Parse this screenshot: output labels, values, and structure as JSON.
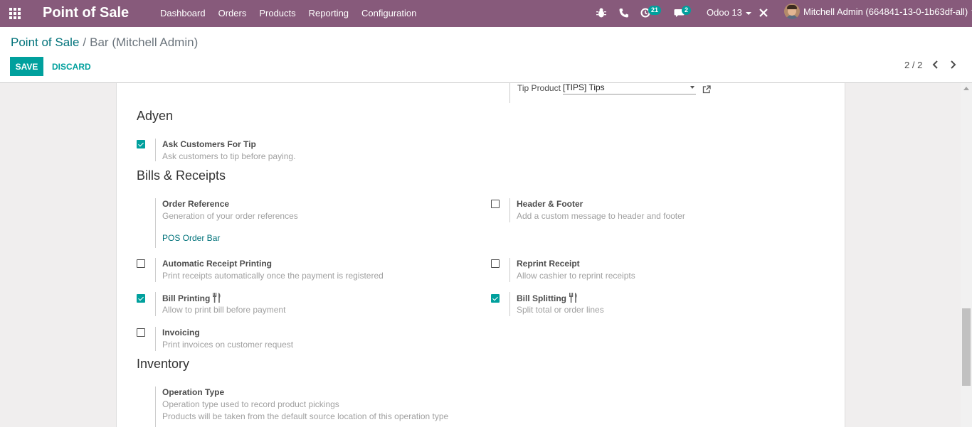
{
  "navbar": {
    "brand": "Point of Sale",
    "menu": [
      "Dashboard",
      "Orders",
      "Products",
      "Reporting",
      "Configuration"
    ],
    "activity_count": "21",
    "message_count": "2",
    "db_switcher": "Odoo 13",
    "user_name": "Mitchell Admin (664841-13-0-1b63df-all)"
  },
  "breadcrumb": {
    "parent": "Point of Sale",
    "separator": "/",
    "current": "Bar (Mitchell Admin)"
  },
  "buttons": {
    "save": "SAVE",
    "discard": "DISCARD"
  },
  "pager": {
    "value": "2 / 2"
  },
  "tip": {
    "label": "Tip Product",
    "value": "[TIPS] Tips"
  },
  "sections": {
    "adyen": "Adyen",
    "bills": "Bills & Receipts",
    "inventory": "Inventory"
  },
  "settings": {
    "ask_tip": {
      "label": "Ask Customers For Tip",
      "help": "Ask customers to tip before paying.",
      "checked": true
    },
    "order_ref": {
      "label": "Order Reference",
      "help": "Generation of your order references",
      "link": "POS Order Bar"
    },
    "header_footer": {
      "label": "Header & Footer",
      "help": "Add a custom message to header and footer",
      "checked": false
    },
    "auto_print": {
      "label": "Automatic Receipt Printing",
      "help": "Print receipts automatically once the payment is registered",
      "checked": false
    },
    "reprint": {
      "label": "Reprint Receipt",
      "help": "Allow cashier to reprint receipts",
      "checked": false
    },
    "bill_printing": {
      "label": "Bill Printing",
      "help": "Allow to print bill before payment",
      "checked": true
    },
    "bill_splitting": {
      "label": "Bill Splitting",
      "help": "Split total or order lines",
      "checked": true
    },
    "invoicing": {
      "label": "Invoicing",
      "help": "Print invoices on customer request",
      "checked": false
    },
    "operation_type": {
      "label": "Operation Type",
      "help1": "Operation type used to record product pickings",
      "help2": "Products will be taken from the default source location of this operation type"
    }
  },
  "colors": {
    "navbar": "#875a7b",
    "accent": "#00a09d",
    "link": "#00727a"
  },
  "icons": [
    "apps-grid-icon",
    "bug-icon",
    "phone-icon",
    "activity-clock-icon",
    "chat-icon",
    "close-x-icon",
    "chevron-left-icon",
    "chevron-right-icon",
    "external-link-icon",
    "utensils-icon"
  ]
}
